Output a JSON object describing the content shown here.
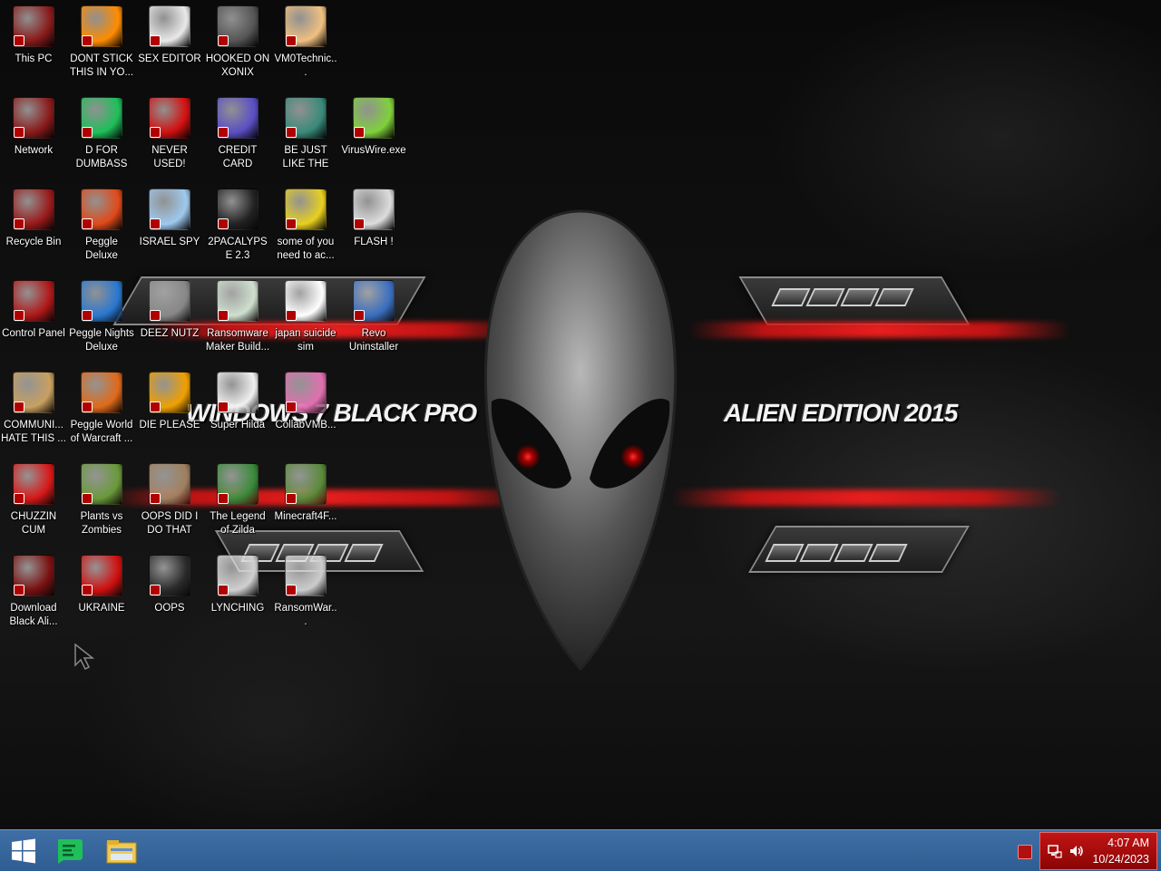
{
  "wallpaper": {
    "text_left": "WINDOWS 7 BLACK PRO",
    "text_right": "ALIEN EDITION 2015"
  },
  "desktop_icons": [
    {
      "label": "This PC",
      "icon": "computer-icon",
      "color": "#8a1a1a"
    },
    {
      "label": "DONT STICK THIS IN YO...",
      "icon": "vlc-cone-icon",
      "color": "#ff8c00"
    },
    {
      "label": "SEX EDITOR",
      "icon": "hxd-hex-editor-icon",
      "color": "#e9e9e9"
    },
    {
      "label": "HOOKED ON XONIX",
      "icon": "xonix-game-icon",
      "color": "#555555"
    },
    {
      "label": "VM0Technic...",
      "icon": "doctor-icon",
      "color": "#f0c080"
    },
    {
      "label": "Network",
      "icon": "network-icon",
      "color": "#8a1a1a"
    },
    {
      "label": "D FOR DUMBASS",
      "icon": "chat-bubble-icon",
      "color": "#1fbf5a"
    },
    {
      "label": "NEVER USED!",
      "icon": "devcpp-icon",
      "color": "#d31010"
    },
    {
      "label": "CREDIT CARD CHECKER",
      "icon": "credit-card-icon",
      "color": "#5a4fc4"
    },
    {
      "label": "BE JUST LIKE THE DUDE!",
      "icon": "christmas-elf-icon",
      "color": "#3a8a7a"
    },
    {
      "label": "VirusWire.exe",
      "icon": "limewire-icon",
      "color": "#7fd13b"
    },
    {
      "label": "Recycle Bin",
      "icon": "recycle-bin-icon",
      "color": "#9a1a1a"
    },
    {
      "label": "Peggle Deluxe",
      "icon": "peggle-icon",
      "color": "#e04a1a"
    },
    {
      "label": "ISRAEL SPY",
      "icon": "remote-desktop-icon",
      "color": "#9ec9ee"
    },
    {
      "label": "2PACALYPSE 2.3",
      "icon": "terminal-icon",
      "color": "#222222"
    },
    {
      "label": "some of you need to ac...",
      "icon": "beaver-icon",
      "color": "#e8d020"
    },
    {
      "label": "FLASH !",
      "icon": "flash-file-icon",
      "color": "#dddddd"
    },
    {
      "label": "Control Panel",
      "icon": "control-panel-icon",
      "color": "#b01818"
    },
    {
      "label": "Peggle Nights Deluxe",
      "icon": "peggle-nights-icon",
      "color": "#2a78d0"
    },
    {
      "label": "DEEZ NUTZ",
      "icon": "stacked-windows-icon",
      "color": "#888888"
    },
    {
      "label": "Ransomware Maker Build...",
      "icon": "window-app-icon",
      "color": "#cfe0cf"
    },
    {
      "label": "japan suicide sim",
      "icon": "document-icon",
      "color": "#ffffff"
    },
    {
      "label": "Revo Uninstaller",
      "icon": "revo-uninstaller-icon",
      "color": "#3a6fc0"
    },
    {
      "label": "COMMUNI... HATE THIS ...",
      "icon": "money-bag-icon",
      "color": "#c9a060"
    },
    {
      "label": "Peggle World of Warcraft ...",
      "icon": "peggle-wow-icon",
      "color": "#e06a1a"
    },
    {
      "label": "DIE PLEASE",
      "icon": "adobe-dreamweaver-icon",
      "color": "#f0a000"
    },
    {
      "label": "Super Hilda",
      "icon": "pixel-cat-icon",
      "color": "#f0f0f0"
    },
    {
      "label": "CollabVMB...",
      "icon": "media-icon",
      "color": "#e070b0"
    },
    {
      "label": "CHUZZIN CUM",
      "icon": "chuzzle-icon",
      "color": "#d81818"
    },
    {
      "label": "Plants vs Zombies",
      "icon": "flower-icon",
      "color": "#6a9a3a"
    },
    {
      "label": "OOPS DID I DO THAT",
      "icon": "portrait-icon",
      "color": "#a08060"
    },
    {
      "label": "The Legend of Zilda",
      "icon": "pixel-hero-icon",
      "color": "#3a8a3a"
    },
    {
      "label": "Minecraft4F...",
      "icon": "grass-block-icon",
      "color": "#5a8a3a"
    },
    {
      "label": "Download Black Ali...",
      "icon": "alien-orb-icon",
      "color": "#7a1010"
    },
    {
      "label": "UKRAINE",
      "icon": "radiation-icon",
      "color": "#d01010"
    },
    {
      "label": "OOPS",
      "icon": "dark-box-icon",
      "color": "#2a2a2a"
    },
    {
      "label": "LYNCHING",
      "icon": "gear-shield-icon",
      "color": "#d0d0d0"
    },
    {
      "label": "RansomWar...",
      "icon": "skull-icon",
      "color": "#cccccc"
    }
  ],
  "taskbar": {
    "start_icon": "windows-logo-icon",
    "pinned": [
      {
        "name": "chat-bubble-icon",
        "color": "#1fbf5a"
      },
      {
        "name": "file-explorer-icon",
        "color": "#f2c94c"
      }
    ],
    "tray_icons": [
      "network-tray-icon",
      "volume-tray-icon"
    ],
    "clock_time": "4:07 AM",
    "clock_date": "10/24/2023"
  }
}
